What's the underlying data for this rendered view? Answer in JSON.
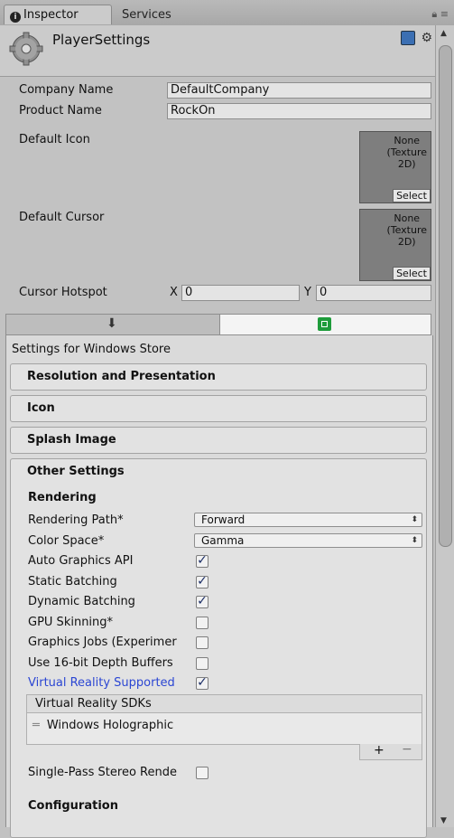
{
  "tabs": {
    "active": "Inspector",
    "inactive": "Services"
  },
  "header": {
    "title": "PlayerSettings"
  },
  "fields": {
    "company_label": "Company Name",
    "company_value": "DefaultCompany",
    "product_label": "Product Name",
    "product_value": "RockOn",
    "icon_label": "Default Icon",
    "cursor_label": "Default Cursor",
    "texture_none": "None\n(Texture\n2D)",
    "select_label": "Select",
    "hotspot_label": "Cursor Hotspot",
    "x_label": "X",
    "x_value": "0",
    "y_label": "Y",
    "y_value": "0"
  },
  "platform": {
    "settings_for": "Settings for Windows Store"
  },
  "sections": [
    "Resolution and Presentation",
    "Icon",
    "Splash Image",
    "Other Settings"
  ],
  "rendering": {
    "heading": "Rendering",
    "path_label": "Rendering Path*",
    "path_value": "Forward",
    "color_label": "Color Space*",
    "color_value": "Gamma",
    "auto_api": "Auto Graphics API",
    "static_batching": "Static Batching",
    "dynamic_batching": "Dynamic Batching",
    "gpu_skinning": "GPU Skinning*",
    "graphics_jobs": "Graphics Jobs (Experimer",
    "depth16": "Use 16-bit Depth Buffers",
    "vr_supported": "Virtual Reality Supported",
    "vr_sdks": "Virtual Reality SDKs",
    "sdk_item": "Windows Holographic",
    "single_pass": "Single-Pass Stereo Rende"
  },
  "configuration": {
    "heading": "Configuration"
  }
}
